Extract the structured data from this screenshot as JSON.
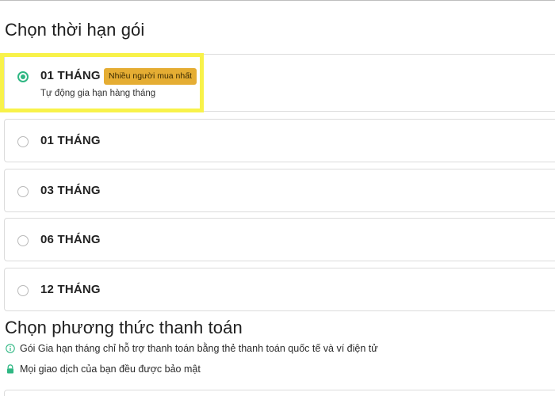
{
  "plan_section": {
    "title": "Chọn thời hạn gói",
    "plans": [
      {
        "label": "01 THÁNG",
        "badge": "Nhiều người mua nhất",
        "subtitle": "Tự động gia hạn hàng tháng",
        "selected": true
      },
      {
        "label": "01 THÁNG",
        "selected": false
      },
      {
        "label": "03 THÁNG",
        "selected": false
      },
      {
        "label": "06 THÁNG",
        "selected": false
      },
      {
        "label": "12 THÁNG",
        "selected": false
      }
    ]
  },
  "payment_section": {
    "title": "Chọn phương thức thanh toán",
    "notes": [
      {
        "icon": "info-icon",
        "text": "Gói Gia hạn tháng chỉ hỗ trợ thanh toán bằng thẻ thanh toán quốc tế và ví điện tử"
      },
      {
        "icon": "lock-icon",
        "text": "Mọi giao dịch của bạn đều được bảo mật"
      }
    ]
  },
  "colors": {
    "accent_green": "#2fb783",
    "badge_bg": "#e5ad33",
    "highlight": "#f8f24a"
  }
}
